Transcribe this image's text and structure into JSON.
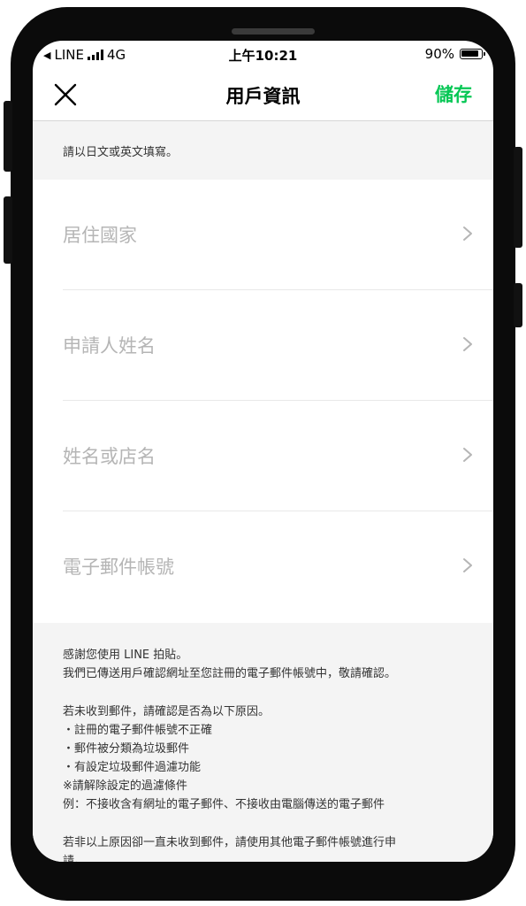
{
  "status_bar": {
    "carrier": "LINE",
    "network": "4G",
    "time": "上午10:21",
    "battery_percent_text": "90%",
    "battery_level": 0.9
  },
  "nav": {
    "title": "用戶資訊",
    "save_label": "儲存",
    "accent_color": "#06c755"
  },
  "notice": "請以日文或英文填寫。",
  "fields": [
    {
      "label": "居住國家"
    },
    {
      "label": "申請人姓名"
    },
    {
      "label": "姓名或店名"
    },
    {
      "label": "電子郵件帳號"
    }
  ],
  "info": {
    "intro": [
      "感謝您使用 LINE 拍貼。",
      "我們已傳送用戶確認網址至您註冊的電子郵件帳號中，敬請確認。"
    ],
    "reasons": [
      "若未收到郵件，請確認是否為以下原因。",
      "・註冊的電子郵件帳號不正確",
      "・郵件被分類為垃圾郵件",
      "・有設定垃圾郵件過濾功能",
      "※請解除設定的過濾條件",
      "例：不接收含有網址的電子郵件、不接收由電腦傳送的電子郵件"
    ],
    "footer": [
      "若非以上原因卻一直未收到郵件，請使用其他電子郵件帳號進行申",
      "請。"
    ]
  }
}
